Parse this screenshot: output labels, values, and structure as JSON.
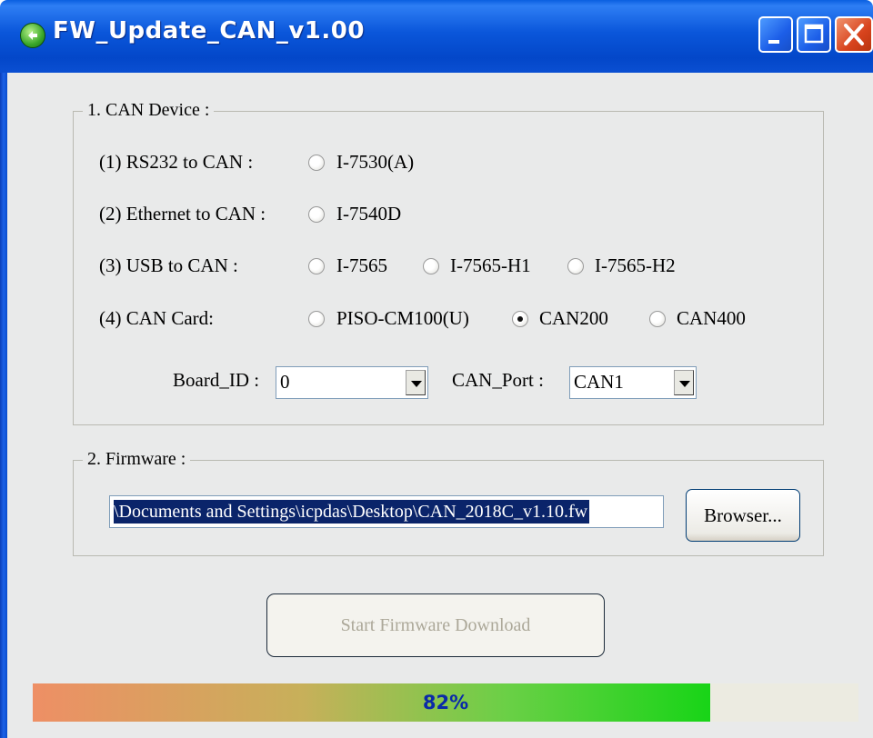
{
  "window": {
    "title": "FW_Update_CAN_v1.00"
  },
  "can_device": {
    "legend": "1. CAN Device :",
    "rows": [
      {
        "label": "(1) RS232 to CAN :",
        "options": [
          {
            "label": "I-7530(A)",
            "checked": false
          }
        ]
      },
      {
        "label": "(2) Ethernet to CAN :",
        "options": [
          {
            "label": "I-7540D",
            "checked": false
          }
        ]
      },
      {
        "label": "(3) USB to CAN :",
        "options": [
          {
            "label": "I-7565",
            "checked": false
          },
          {
            "label": "I-7565-H1",
            "checked": false
          },
          {
            "label": "I-7565-H2",
            "checked": false
          }
        ]
      },
      {
        "label": "(4) CAN Card:",
        "options": [
          {
            "label": "PISO-CM100(U)",
            "checked": false
          },
          {
            "label": "CAN200",
            "checked": true
          },
          {
            "label": "CAN400",
            "checked": false
          }
        ]
      }
    ],
    "board_id": {
      "label": "Board_ID :",
      "value": "0"
    },
    "can_port": {
      "label": "CAN_Port :",
      "value": "CAN1"
    }
  },
  "firmware": {
    "legend": "2. Firmware :",
    "path": "\\Documents and Settings\\icpdas\\Desktop\\CAN_2018C_v1.10.fw",
    "browse_label": "Browser..."
  },
  "start_button": {
    "label": "Start Firmware Download",
    "enabled": false
  },
  "progress": {
    "percent": 82,
    "label": "82%"
  }
}
